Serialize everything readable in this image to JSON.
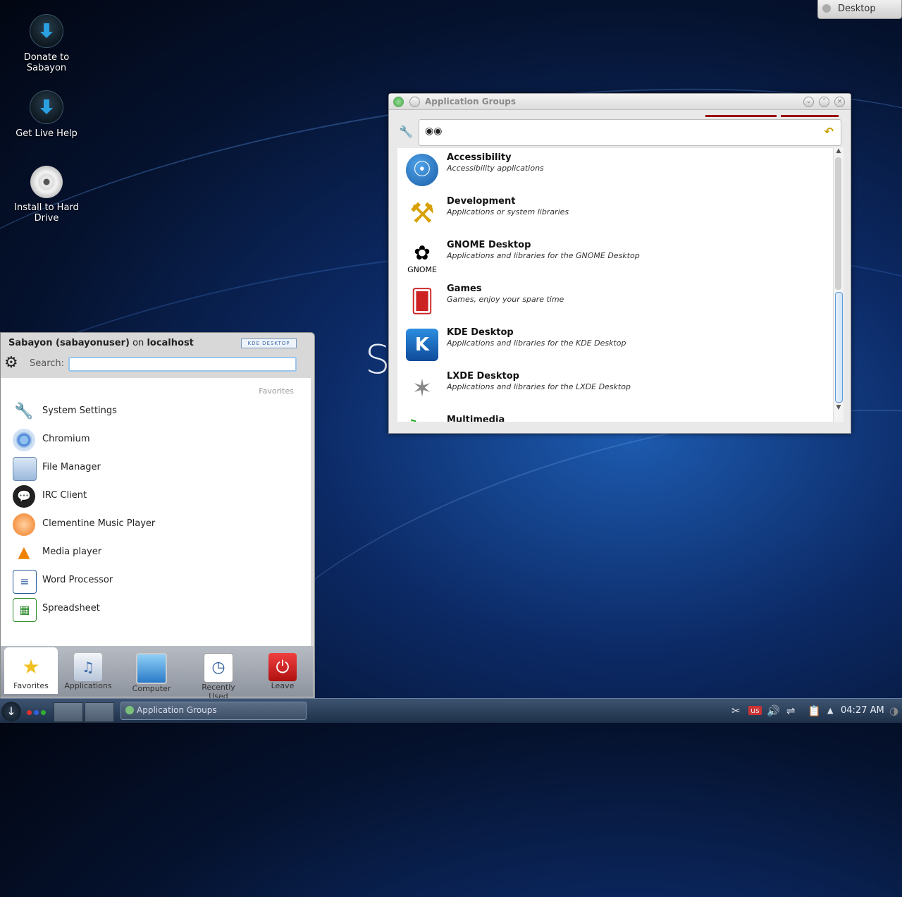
{
  "desktop": {
    "brand": "S",
    "icons": [
      {
        "label": "Donate to Sabayon"
      },
      {
        "label": "Get Live Help"
      },
      {
        "label": "Install to Hard Drive"
      }
    ],
    "desktop_button": "Desktop"
  },
  "window": {
    "title": "Application Groups",
    "groups": [
      {
        "name": "Accessibility",
        "desc": "Accessibility applications",
        "icon": "accessibility-icon"
      },
      {
        "name": "Development",
        "desc": "Applications or system libraries",
        "icon": "hammer-icon"
      },
      {
        "name": "GNOME Desktop",
        "desc": "Applications and libraries for the GNOME Desktop",
        "icon": "gnome-foot-icon"
      },
      {
        "name": "Games",
        "desc": "Games, enjoy your spare time",
        "icon": "playing-cards-icon"
      },
      {
        "name": "KDE Desktop",
        "desc": "Applications and libraries for the KDE Desktop",
        "icon": "kde-logo-icon"
      },
      {
        "name": "LXDE Desktop",
        "desc": "Applications and libraries for the LXDE Desktop",
        "icon": "lxde-logo-icon"
      },
      {
        "name": "Multimedia",
        "desc": "",
        "icon": "multimedia-icon"
      }
    ],
    "gnome_icon_caption": "GNOME"
  },
  "launcher": {
    "user": "Sabayon (sabayonuser)",
    "on": "on",
    "host": "localhost",
    "kde_badge": "KDE DESKTOP",
    "search_label": "Search:",
    "search_value": "",
    "favorites_label": "Favorites",
    "favorites": [
      {
        "label": "System Settings",
        "icon": "settings-tools-icon"
      },
      {
        "label": "Chromium",
        "icon": "chromium-icon"
      },
      {
        "label": "File Manager",
        "icon": "file-manager-icon"
      },
      {
        "label": "IRC Client",
        "icon": "irc-icon"
      },
      {
        "label": "Clementine Music Player",
        "icon": "clementine-icon"
      },
      {
        "label": "Media player",
        "icon": "vlc-cone-icon"
      },
      {
        "label": "Word Processor",
        "icon": "word-processor-icon"
      },
      {
        "label": "Spreadsheet",
        "icon": "spreadsheet-icon"
      }
    ],
    "tabs": [
      {
        "label": "Favorites",
        "icon": "star-icon"
      },
      {
        "label": "Applications",
        "icon": "applications-icon"
      },
      {
        "label": "Computer",
        "icon": "computer-icon"
      },
      {
        "label": "Recently Used",
        "icon": "clock-icon"
      },
      {
        "label": "Leave",
        "icon": "power-icon"
      }
    ]
  },
  "taskbar": {
    "task": "Application Groups",
    "keyboard_layout": "us",
    "clock": "04:27 AM"
  }
}
